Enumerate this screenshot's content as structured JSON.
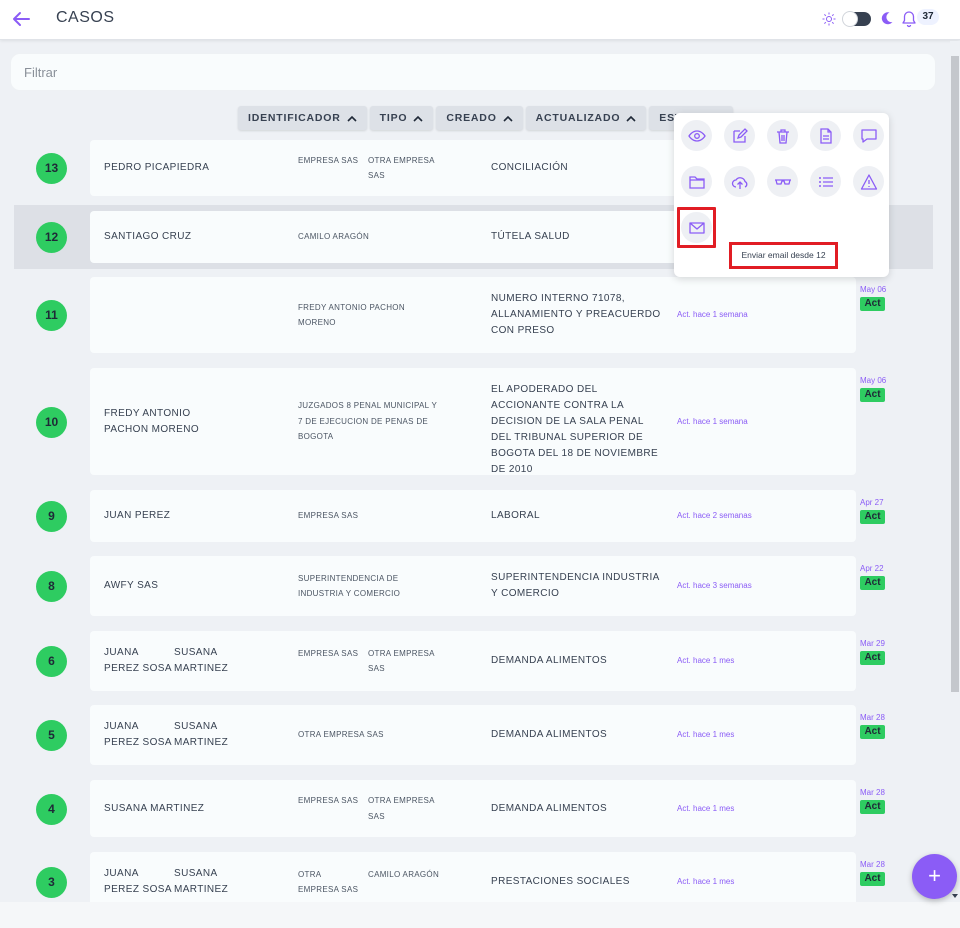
{
  "header": {
    "title": "CASOS",
    "notification_count": "37"
  },
  "filter": {
    "placeholder": "Filtrar"
  },
  "sort_buttons": [
    "IDENTIFICADOR",
    "TIPO",
    "CREADO",
    "ACTUALIZADO",
    "ESTADO"
  ],
  "colors": {
    "accent": "#8b5cf6",
    "badge_green": "#2ecc61",
    "highlight_red": "#e11d24"
  },
  "rows": [
    {
      "id": "13",
      "name": [
        "PEDRO PICAPIEDRA"
      ],
      "parties": [
        "EMPRESA SAS",
        "OTRA EMPRESA SAS"
      ],
      "subject": "CONCILIACIÓN",
      "updated": "",
      "date": "",
      "status": ""
    },
    {
      "id": "12",
      "name": [
        "SANTIAGO CRUZ"
      ],
      "parties": [
        "CAMILO ARAGÓN"
      ],
      "subject": "TÚTELA SALUD",
      "updated": "",
      "date": "",
      "status": "",
      "selected": true
    },
    {
      "id": "11",
      "name": [],
      "parties": [
        "FREDY ANTONIO PACHON MORENO"
      ],
      "subject": "NUMERO INTERNO 71078, ALLANAMIENTO Y PREACUERDO CON PRESO",
      "updated": "Act. hace 1 semana",
      "date": "May 06",
      "status": "Act"
    },
    {
      "id": "10",
      "name": [
        "FREDY ANTONIO PACHON MORENO"
      ],
      "parties": [
        "JUZGADOS 8 PENAL MUNICIPAL Y 7 DE EJECUCION DE PENAS DE BOGOTA"
      ],
      "subject": "EL APODERADO DEL ACCIONANTE CONTRA LA DECISION DE LA SALA PENAL DEL TRIBUNAL SUPERIOR DE BOGOTA DEL 18 DE NOVIEMBRE DE 2010",
      "updated": "Act. hace 1 semana",
      "date": "May 06",
      "status": "Act"
    },
    {
      "id": "9",
      "name": [
        "JUAN PEREZ"
      ],
      "parties": [
        "EMPRESA SAS"
      ],
      "subject": "LABORAL",
      "updated": "Act. hace 2 semanas",
      "date": "Apr 27",
      "status": "Act"
    },
    {
      "id": "8",
      "name": [
        "AWFY SAS"
      ],
      "parties": [
        "SUPERINTENDENCIA DE INDUSTRIA Y COMERCIO"
      ],
      "subject": "SUPERINTENDENCIA INDUSTRIA Y COMERCIO",
      "updated": "Act. hace 3 semanas",
      "date": "Apr 22",
      "status": "Act"
    },
    {
      "id": "6",
      "name": [
        "JUANA PEREZ SOSA",
        "SUSANA MARTINEZ"
      ],
      "parties": [
        "EMPRESA SAS",
        "OTRA EMPRESA SAS"
      ],
      "subject": "DEMANDA ALIMENTOS",
      "updated": "Act. hace 1 mes",
      "date": "Mar 29",
      "status": "Act"
    },
    {
      "id": "5",
      "name": [
        "JUANA PEREZ SOSA",
        "SUSANA MARTINEZ"
      ],
      "parties": [
        "OTRA EMPRESA SAS"
      ],
      "subject": "DEMANDA ALIMENTOS",
      "updated": "Act. hace 1 mes",
      "date": "Mar 28",
      "status": "Act"
    },
    {
      "id": "4",
      "name": [
        "SUSANA MARTINEZ"
      ],
      "parties": [
        "EMPRESA SAS",
        "OTRA EMPRESA SAS"
      ],
      "subject": "DEMANDA ALIMENTOS",
      "updated": "Act. hace 1 mes",
      "date": "Mar 28",
      "status": "Act"
    },
    {
      "id": "3",
      "name": [
        "JUANA PEREZ SOSA",
        "SUSANA MARTINEZ"
      ],
      "parties": [
        "OTRA EMPRESA SAS",
        "CAMILO ARAGÓN"
      ],
      "subject": "PRESTACIONES SOCIALES",
      "updated": "Act. hace 1 mes",
      "date": "Mar 28",
      "status": "Act"
    }
  ],
  "actions_menu": {
    "icons": [
      "eye-icon",
      "edit-icon",
      "trash-icon",
      "document-icon",
      "chat-icon",
      "folder-icon",
      "cloud-upload-icon",
      "glasses-icon",
      "list-icon",
      "warning-icon",
      "mail-icon"
    ],
    "tooltip": "Enviar email desde 12"
  },
  "fab": {
    "label": "+"
  }
}
